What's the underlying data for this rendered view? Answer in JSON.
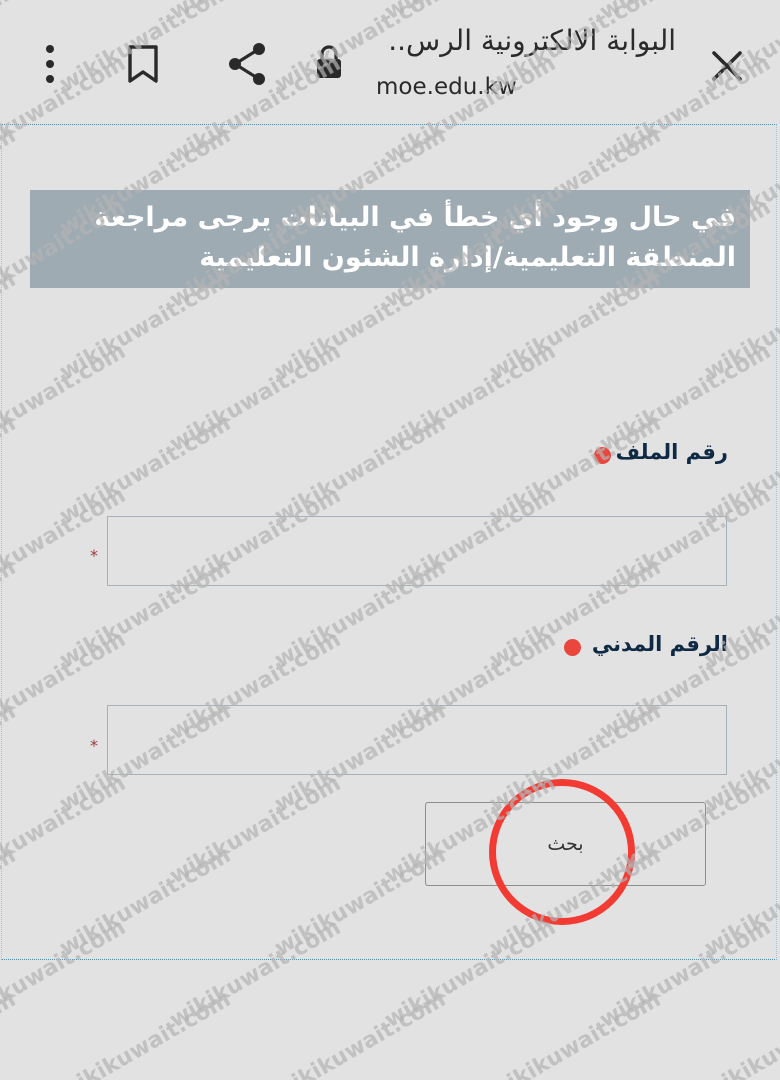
{
  "browser": {
    "title": "البوابة الالكترونية الرس..",
    "url": "moe.edu.kw",
    "icons": [
      "close-icon",
      "lock-icon",
      "share-icon",
      "bookmark-icon",
      "more-vert-icon"
    ]
  },
  "notice": {
    "line1": "في حال وجود أي خطأ في البيانات يرجى مراجعة",
    "line2": "المنطقة التعليمية/إدارة الشئون التعليمية"
  },
  "form": {
    "file_number_label": "رقم الملف",
    "file_number_value": "",
    "civil_id_label": "الرقم المدني",
    "civil_id_value": "",
    "required_mark": "*",
    "search_label": "بحث"
  },
  "watermark": {
    "text": "wikikuwait.com"
  },
  "colors": {
    "background": "#e2e2e2",
    "notice_bg": "#9eabb3",
    "label": "#0f2a45",
    "bullet": "#e9473e",
    "highlight": "#f23b33"
  }
}
